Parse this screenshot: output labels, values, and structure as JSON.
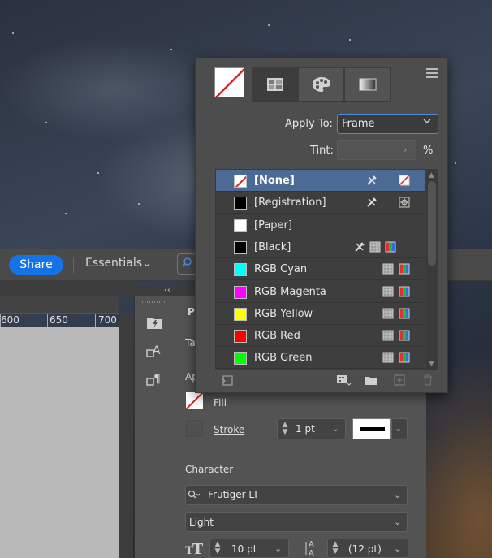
{
  "topbar": {
    "share_label": "Share",
    "workspace_label": "Essentials"
  },
  "ruler": {
    "ticks": [
      "600",
      "650",
      "700"
    ]
  },
  "properties": {
    "title_initial": "P",
    "tab_initial": "Ta",
    "appearance_initial": "Ap",
    "fill_label": "Fill",
    "stroke_label": "Stroke",
    "stroke_weight": "1 pt",
    "character_label": "Character",
    "font_family": "Frutiger LT",
    "font_style": "Light",
    "font_size": "10 pt",
    "leading": "(12 pt)"
  },
  "swatches_panel": {
    "apply_to_label": "Apply To:",
    "apply_to_value": "Frame",
    "tint_label": "Tint:",
    "tint_value": "",
    "percent_label": "%",
    "swatches": [
      {
        "name": "[None]",
        "color": "none",
        "selected": true,
        "icons": [
          "no-edit-icon",
          "none-type-icon"
        ]
      },
      {
        "name": "[Registration]",
        "color": "#000000",
        "selected": false,
        "icons": [
          "no-edit-icon",
          "registration-type-icon"
        ]
      },
      {
        "name": "[Paper]",
        "color": "#ffffff",
        "selected": false,
        "icons": []
      },
      {
        "name": "[Black]",
        "color": "#000000",
        "selected": false,
        "icons": [
          "no-edit-icon",
          "process-type-icon",
          "rgb-mode-icon"
        ]
      },
      {
        "name": "RGB Cyan",
        "color": "#00ffff",
        "selected": false,
        "icons": [
          "process-type-icon",
          "rgb-mode-icon"
        ]
      },
      {
        "name": "RGB Magenta",
        "color": "#ff00ff",
        "selected": false,
        "icons": [
          "process-type-icon",
          "rgb-mode-icon"
        ]
      },
      {
        "name": "RGB Yellow",
        "color": "#ffff00",
        "selected": false,
        "icons": [
          "process-type-icon",
          "rgb-mode-icon"
        ]
      },
      {
        "name": "RGB Red",
        "color": "#ff0000",
        "selected": false,
        "icons": [
          "process-type-icon",
          "rgb-mode-icon"
        ]
      },
      {
        "name": "RGB Green",
        "color": "#00ff00",
        "selected": false,
        "icons": [
          "process-type-icon",
          "rgb-mode-icon"
        ]
      }
    ]
  }
}
